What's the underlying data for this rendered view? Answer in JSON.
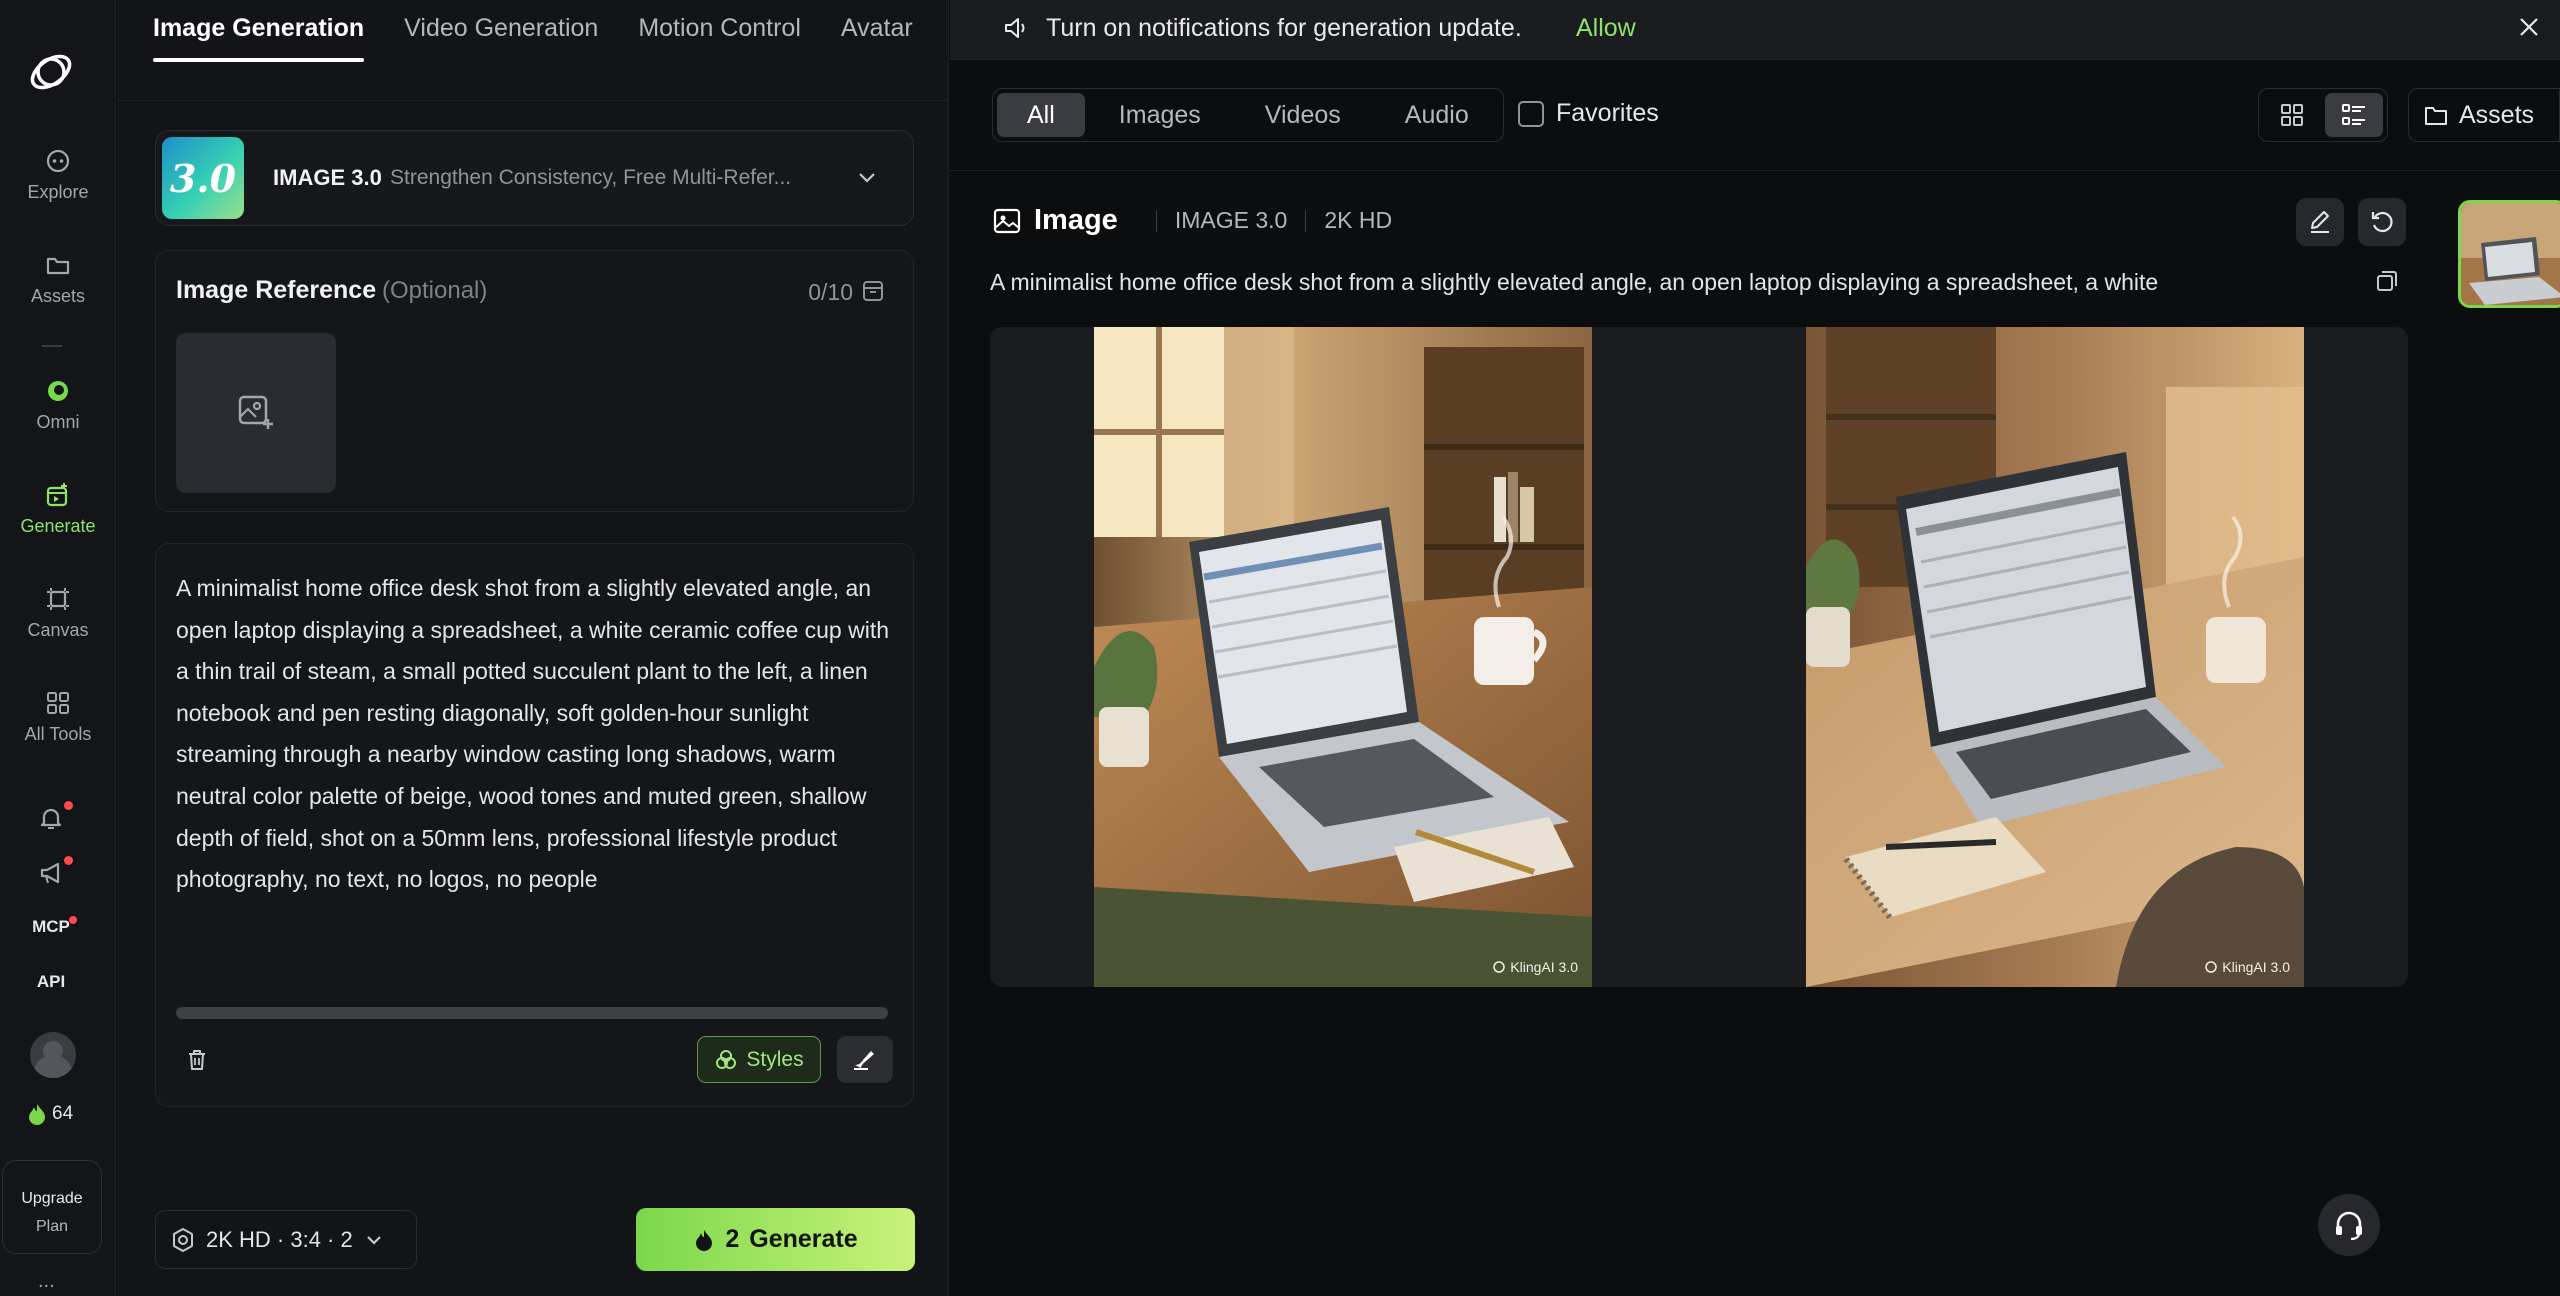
{
  "rail": {
    "items": [
      {
        "label": "Explore",
        "icon": "explore-icon"
      },
      {
        "label": "Assets",
        "icon": "folder-icon"
      },
      {
        "label": "Omni",
        "icon": "omni-icon"
      },
      {
        "label": "Generate",
        "icon": "generate-icon"
      },
      {
        "label": "Canvas",
        "icon": "canvas-icon"
      },
      {
        "label": "All Tools",
        "icon": "grid-icon"
      }
    ],
    "mcp": "MCP",
    "api": "API",
    "credits": "64",
    "upgrade": "Upgrade",
    "plan": "Plan",
    "more": "..."
  },
  "panel": {
    "tabs": [
      "Image Generation",
      "Video Generation",
      "Motion Control",
      "Avatar"
    ],
    "model": {
      "badge": "3.0",
      "name": "IMAGE 3.0",
      "desc": "Strengthen Consistency, Free Multi-Refer..."
    },
    "reference": {
      "title": "Image Reference",
      "optional": "(Optional)",
      "count": "0/10"
    },
    "prompt": "A minimalist home office desk shot from a slightly elevated angle, an open laptop displaying a spreadsheet, a white ceramic coffee cup with a thin trail of steam, a small potted succulent plant to the left, a linen notebook and pen resting diagonally, soft golden-hour sunlight streaming through a nearby window casting long shadows, warm neutral color palette of beige, wood tones and muted green, shallow depth of field, shot on a 50mm lens, professional lifestyle product photography, no text, no logos, no people",
    "styles_label": "Styles",
    "settings": "2K HD · 3:4 · 2",
    "generate": {
      "cost": "2",
      "label": "Generate"
    }
  },
  "main": {
    "notification": {
      "text": "Turn on notifications for generation update.",
      "allow": "Allow"
    },
    "filters": [
      "All",
      "Images",
      "Videos",
      "Audio"
    ],
    "favorites": "Favorites",
    "assets": "Assets",
    "result": {
      "title": "Image",
      "model": "IMAGE 3.0",
      "quality": "2K HD",
      "prompt": "A minimalist home office desk shot from a slightly elevated angle, an open laptop displaying a spreadsheet, a white",
      "watermark": "KlingAI 3.0"
    }
  },
  "colors": {
    "accent": "#8ee36a",
    "background": "#0c0d0f",
    "panel": "#131417"
  }
}
